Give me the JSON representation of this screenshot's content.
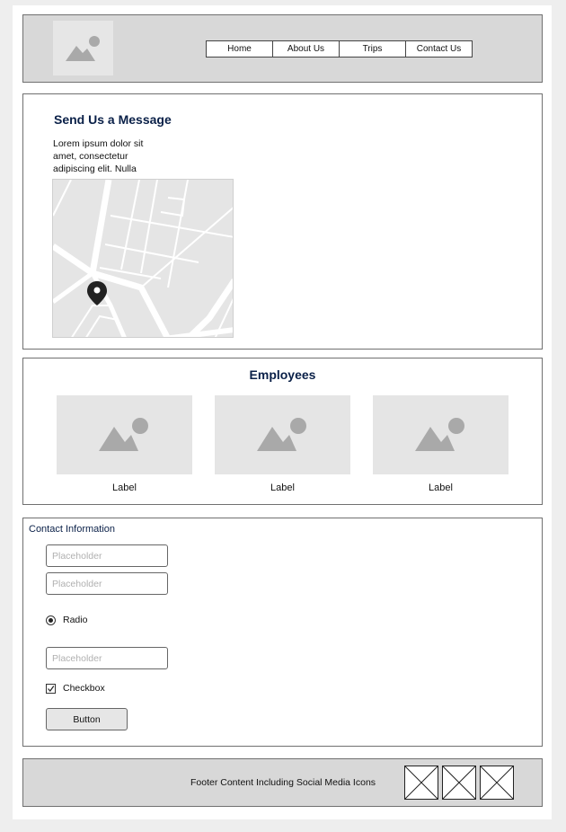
{
  "header": {
    "logo_icon": "image-placeholder-icon",
    "nav": [
      "Home",
      "About Us",
      "Trips",
      "Contact Us"
    ]
  },
  "message": {
    "title": "Send Us a Message",
    "text": "Lorem ipsum dolor sit amet, consectetur adipiscing elit. Nulla",
    "map_icon": "map-pin-icon"
  },
  "employees": {
    "title": "Employees",
    "cards": [
      {
        "label": "Label",
        "icon": "image-placeholder-icon"
      },
      {
        "label": "Label",
        "icon": "image-placeholder-icon"
      },
      {
        "label": "Label",
        "icon": "image-placeholder-icon"
      }
    ]
  },
  "contact": {
    "title": "Contact Information",
    "inputs": [
      {
        "placeholder": "Placeholder",
        "value": ""
      },
      {
        "placeholder": "Placeholder",
        "value": ""
      },
      {
        "placeholder": "Placeholder",
        "value": ""
      }
    ],
    "radio_label": "Radio",
    "radio_checked": true,
    "checkbox_label": "Checkbox",
    "checkbox_checked": true,
    "button_label": "Button"
  },
  "footer": {
    "text": "Footer Content Including Social Media Icons",
    "social_icons": [
      "social-placeholder-icon",
      "social-placeholder-icon",
      "social-placeholder-icon"
    ]
  },
  "colors": {
    "heading": "#0a2048",
    "panel": "#d8d8d8",
    "placeholder_fill": "#e5e5e5",
    "border": "#707070"
  }
}
